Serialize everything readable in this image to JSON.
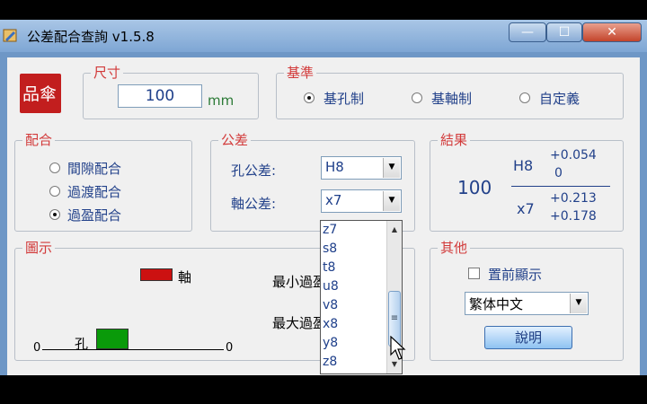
{
  "window": {
    "title": "公差配合查詢 v1.5.8",
    "minimize": "—",
    "maximize": "☐",
    "close": "✕"
  },
  "logo": {
    "text": "品傘"
  },
  "size": {
    "legend": "尺寸",
    "value": "100",
    "unit": "mm"
  },
  "basis": {
    "legend": "基準",
    "options": [
      {
        "label": "基孔制",
        "selected": true
      },
      {
        "label": "基軸制",
        "selected": false
      },
      {
        "label": "自定義",
        "selected": false
      }
    ]
  },
  "fit": {
    "legend": "配合",
    "options": [
      {
        "label": "間隙配合",
        "selected": false
      },
      {
        "label": "過渡配合",
        "selected": false
      },
      {
        "label": "過盈配合",
        "selected": true
      }
    ]
  },
  "tolerance": {
    "legend": "公差",
    "hole_label": "孔公差:",
    "hole_value": "H8",
    "shaft_label": "軸公差:",
    "shaft_value": "x7",
    "dropdown_options": [
      "z7",
      "s8",
      "t8",
      "u8",
      "v8",
      "x8",
      "y8",
      "z8"
    ]
  },
  "result": {
    "legend": "結果",
    "nominal": "100",
    "hole_code": "H8",
    "hole_upper": "+0.054",
    "hole_lower": "0",
    "shaft_code": "x7",
    "shaft_upper": "+0.213",
    "shaft_lower": "+0.178"
  },
  "diagram": {
    "legend": "圖示",
    "shaft_label": "軸",
    "hole_label": "孔",
    "left_zero": "0",
    "right_zero": "0",
    "min_interference": "最小過盈",
    "max_interference": "最大過盈",
    "shaft_color": "#cc1111",
    "hole_color": "#0a9a0a"
  },
  "other": {
    "legend": "其他",
    "topmost_label": "置前顯示",
    "topmost_checked": false,
    "language_value": "繁体中文",
    "help_button": "說明"
  }
}
